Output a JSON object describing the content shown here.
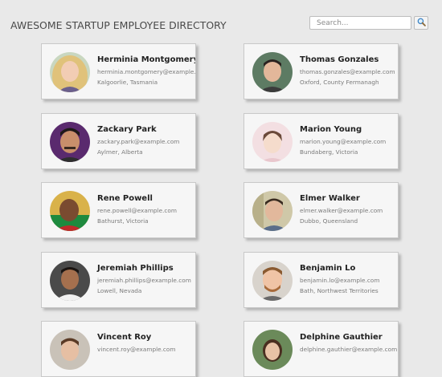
{
  "header": {
    "title": "AWESOME STARTUP EMPLOYEE DIRECTORY",
    "search_placeholder": "Search...",
    "search_value": "",
    "search_icon": "search-icon"
  },
  "employees": [
    {
      "name": "Herminia Montgomery",
      "email": "herminia.montgomery@example.com",
      "location": "Kalgoorlie, Tasmania"
    },
    {
      "name": "Thomas Gonzales",
      "email": "thomas.gonzales@example.com",
      "location": "Oxford, County Fermanagh"
    },
    {
      "name": "Zackary Park",
      "email": "zackary.park@example.com",
      "location": "Aylmer, Alberta"
    },
    {
      "name": "Marion Young",
      "email": "marion.young@example.com",
      "location": "Bundaberg, Victoria"
    },
    {
      "name": "Rene Powell",
      "email": "rene.powell@example.com",
      "location": "Bathurst, Victoria"
    },
    {
      "name": "Elmer Walker",
      "email": "elmer.walker@example.com",
      "location": "Dubbo, Queensland"
    },
    {
      "name": "Jeremiah Phillips",
      "email": "jeremiah.phillips@example.com",
      "location": "Lowell, Nevada"
    },
    {
      "name": "Benjamin Lo",
      "email": "benjamin.lo@example.com",
      "location": "Bath, Northwest Territories"
    },
    {
      "name": "Vincent Roy",
      "email": "vincent.roy@example.com",
      "location": ""
    },
    {
      "name": "Delphine Gauthier",
      "email": "delphine.gauthier@example.com",
      "location": ""
    }
  ]
}
